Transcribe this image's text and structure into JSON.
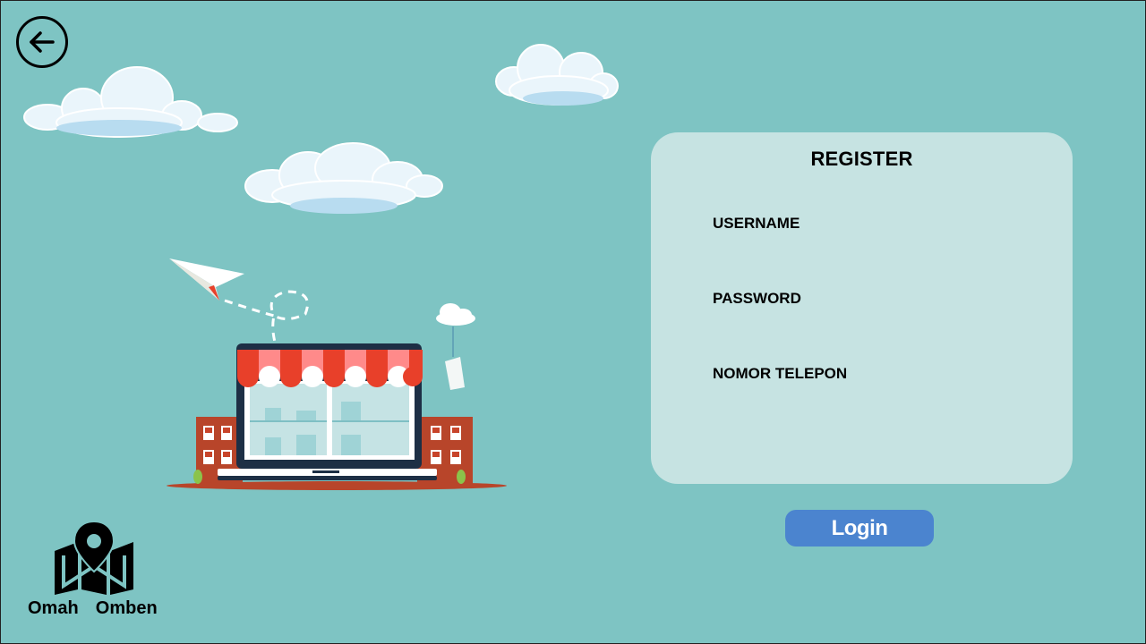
{
  "back_button": {
    "icon": "arrow-left-icon"
  },
  "register": {
    "title": "REGISTER",
    "fields": [
      {
        "label": "USERNAME",
        "value": ""
      },
      {
        "label": "PASSWORD",
        "value": ""
      },
      {
        "label": "NOMOR TELEPON",
        "value": ""
      }
    ]
  },
  "login_button": {
    "label": "Login"
  },
  "brand": {
    "name": "Omah  Omben",
    "icon": "map-pin-icon"
  },
  "colors": {
    "background": "#7ec4c3",
    "card": "#c6e3e2",
    "login_button": "#4b84cf",
    "awning_red": "#e8402a",
    "building": "#b8452a"
  }
}
